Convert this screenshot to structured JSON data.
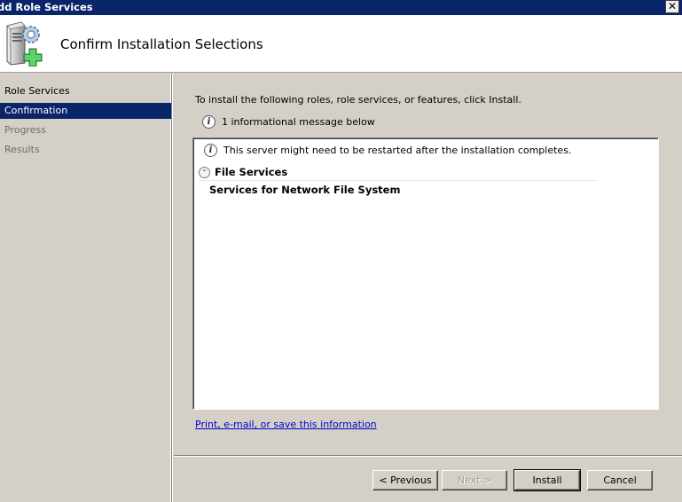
{
  "window": {
    "title": "dd Role Services",
    "close_glyph": "✕"
  },
  "header": {
    "title": "Confirm Installation Selections",
    "icon": "server-add-icon"
  },
  "sidebar": {
    "items": [
      {
        "label": "Role Services",
        "state": "done"
      },
      {
        "label": "Confirmation",
        "state": "current"
      },
      {
        "label": "Progress",
        "state": "future"
      },
      {
        "label": "Results",
        "state": "future"
      }
    ]
  },
  "main": {
    "intro": "To install the following roles, role services, or features, click Install.",
    "info_message": "1 informational message below",
    "list": {
      "warning": "This server might need to be restarted after the installation completes.",
      "section_title": "File Services",
      "items": [
        "Services for Network File System"
      ]
    },
    "print_link": "Print, e-mail, or save this information"
  },
  "buttons": {
    "previous": "< Previous",
    "next": "Next >",
    "install": "Install",
    "cancel": "Cancel"
  },
  "colors": {
    "titlebar": "#0a246a",
    "selection": "#0a246a",
    "dialog_bg": "#d4d0c8",
    "link": "#0000cc"
  }
}
